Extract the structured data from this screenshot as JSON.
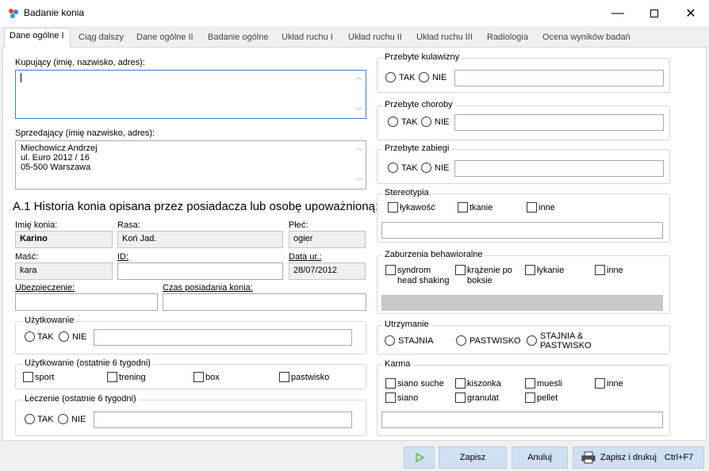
{
  "window": {
    "title": "Badanie konia"
  },
  "tabs": [
    {
      "label": "Dane ogólne I"
    },
    {
      "label": "Ciąg dalszy"
    },
    {
      "label": "Dane ogólne II"
    },
    {
      "label": "Badanie ogólne"
    },
    {
      "label": "Układ ruchu I"
    },
    {
      "label": "Układ ruchu II"
    },
    {
      "label": "Układ ruchu III"
    },
    {
      "label": "Radiologia"
    },
    {
      "label": "Ocena wyników badań"
    }
  ],
  "left": {
    "buyer": {
      "label": "Kupujący (imię, nazwisko, adres):",
      "value": ""
    },
    "seller": {
      "label": "Sprzedający (imię nazwisko, adres):",
      "lines": [
        "Miechowicz Andrzej",
        "ul. Euro 2012 / 16",
        "05-500 Warszawa"
      ]
    },
    "heading": "A.1 Historia konia opisana przez posiadacza lub osobę upoważnioną:",
    "horse_name": {
      "label": "Imię konia:",
      "value": "Karino"
    },
    "breed": {
      "label": "Rasa:",
      "value": "Koń Jad."
    },
    "sex": {
      "label": "Płeć:",
      "value": "ogier"
    },
    "color": {
      "label": "Maść:",
      "value": "kara"
    },
    "id": {
      "label": "ID:",
      "value": ""
    },
    "birth_date": {
      "label": "Data ur.:",
      "value": "28/07/2012"
    },
    "insurance": {
      "label": "Ubezpieczenie:",
      "value": ""
    },
    "ownership_time": {
      "label": "Czas posiadania konia:",
      "value": ""
    },
    "usage": {
      "title": "Użytkowanie",
      "yes": "TAK",
      "no": "NIE"
    },
    "usage6": {
      "title": "Użytkowanie (ostatnie 6 tygodni)",
      "options": [
        "sport",
        "trening",
        "box",
        "pastwisko"
      ]
    },
    "treatment6": {
      "title": "Leczenie (ostatnie 6 tygodni)",
      "yes": "TAK",
      "no": "NIE"
    }
  },
  "right": {
    "lameness": {
      "title": "Przebyte kulawizny",
      "yes": "TAK",
      "no": "NIE"
    },
    "diseases": {
      "title": "Przebyte choroby",
      "yes": "TAK",
      "no": "NIE"
    },
    "procedures": {
      "title": "Przebyte zabiegi",
      "yes": "TAK",
      "no": "NIE"
    },
    "stereotypy": {
      "title": "Stereotypia",
      "options": [
        "łykawość",
        "tkanie",
        "inne"
      ]
    },
    "behavior": {
      "title": "Zaburzenia behawioralne",
      "options": [
        [
          "syndrom",
          "head shaking"
        ],
        [
          "krążenie po",
          "boksie"
        ],
        [
          "łykanie"
        ],
        [
          "inne"
        ]
      ]
    },
    "keeping": {
      "title": "Utrzymanie",
      "options": [
        [
          "STAJNIA"
        ],
        [
          "PASTWISKO"
        ],
        [
          "STAJNIA &",
          "PASTWISKO"
        ]
      ]
    },
    "feed": {
      "title": "Karma",
      "options": [
        "siano suche",
        "kiszonka",
        "muesli",
        "inne",
        "siano",
        "granulat",
        "pellet"
      ]
    }
  },
  "buttons": {
    "save": "Zapisz",
    "cancel": "Anuluj",
    "save_print": "Zapisz i drukuj",
    "save_print_shortcut": "Ctrl+F7"
  },
  "colors": {
    "accent": "#3b7dd8",
    "button_bg": "#cfe0f2",
    "play_icon": "#6fbf3a"
  }
}
